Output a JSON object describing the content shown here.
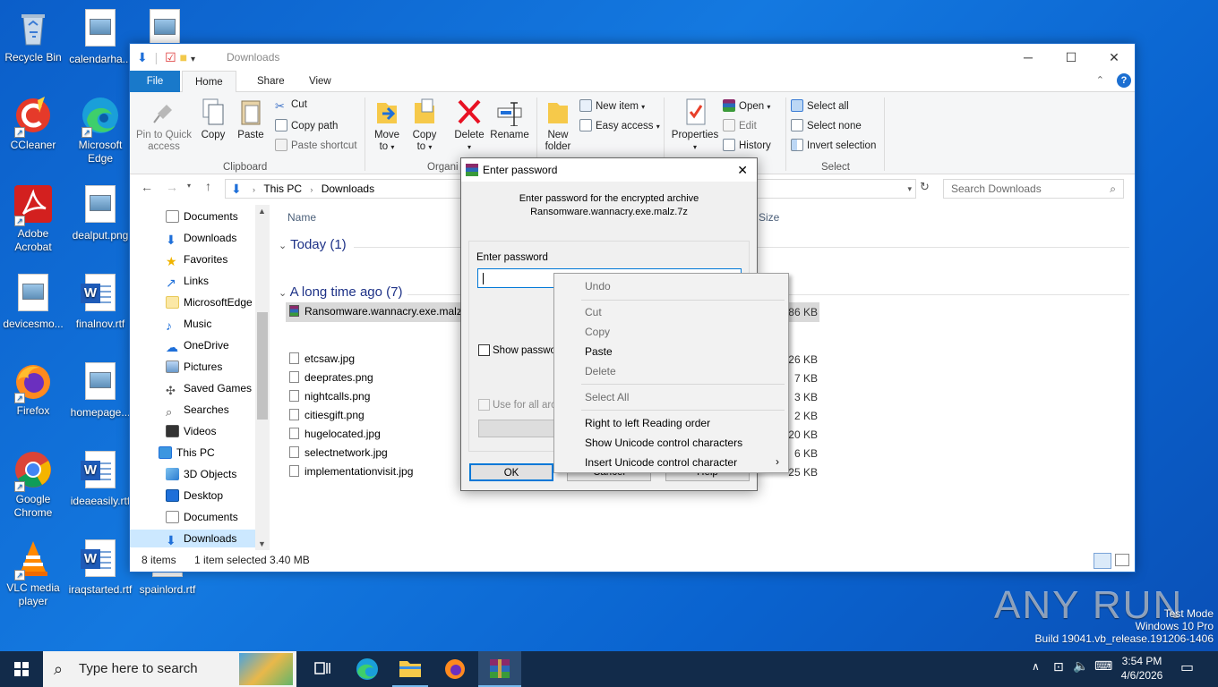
{
  "desktop": {
    "icons": [
      {
        "label": "Recycle Bin"
      },
      {
        "label": "calendarha..."
      },
      {
        "label": "CCleaner"
      },
      {
        "label": "Microsoft Edge"
      },
      {
        "label": "Adobe Acrobat"
      },
      {
        "label": "dealput.png"
      },
      {
        "label": "devicesmo..."
      },
      {
        "label": "finalnov.rtf"
      },
      {
        "label": "Firefox"
      },
      {
        "label": "homepage..."
      },
      {
        "label": "Google Chrome"
      },
      {
        "label": "ideaeasily.rtf"
      },
      {
        "label": "VLC media player"
      },
      {
        "label": "iraqstarted.rtf"
      },
      {
        "label": "spainlord.rtf"
      }
    ]
  },
  "explorer": {
    "title": "Downloads",
    "tabs": {
      "file": "File",
      "home": "Home",
      "share": "Share",
      "view": "View"
    },
    "ribbon": {
      "pin": "Pin to Quick access",
      "copy": "Copy",
      "paste": "Paste",
      "cut": "Cut",
      "copy_path": "Copy path",
      "paste_shortcut": "Paste shortcut",
      "clipboard": "Clipboard",
      "move_to": "Move to",
      "copy_to": "Copy to",
      "delete": "Delete",
      "rename": "Rename",
      "organize": "Organi",
      "new_folder": "New folder",
      "new_item": "New item",
      "easy_access": "Easy access",
      "properties": "Properties",
      "open": "Open",
      "edit": "Edit",
      "history": "History",
      "select_all": "Select all",
      "select_none": "Select none",
      "invert_selection": "Invert selection",
      "select": "Select"
    },
    "address": {
      "this_pc": "This PC",
      "downloads": "Downloads",
      "search_placeholder": "Search Downloads"
    },
    "nav": [
      "Documents",
      "Downloads",
      "Favorites",
      "Links",
      "MicrosoftEdge",
      "Music",
      "OneDrive",
      "Pictures",
      "Saved Games",
      "Searches",
      "Videos",
      "This PC",
      "3D Objects",
      "Desktop",
      "Documents",
      "Downloads"
    ],
    "columns": {
      "name": "Name",
      "size": "Size"
    },
    "groups": {
      "today": "Today (1)",
      "long_ago": "A long time ago (7)"
    },
    "files": [
      {
        "name": "Ransomware.wannacry.exe.malz",
        "size": "3,486 KB"
      },
      {
        "name": "etcsaw.jpg",
        "size": "26 KB"
      },
      {
        "name": "deeprates.png",
        "size": "7 KB"
      },
      {
        "name": "nightcalls.png",
        "size": "3 KB"
      },
      {
        "name": "citiesgift.png",
        "size": "2 KB"
      },
      {
        "name": "hugelocated.jpg",
        "size": "20 KB"
      },
      {
        "name": "selectnetwork.jpg",
        "size": "6 KB"
      },
      {
        "name": "implementationvisit.jpg",
        "size": "25 KB"
      }
    ],
    "status": {
      "items": "8 items",
      "selected": "1 item selected  3.40 MB"
    }
  },
  "dialog": {
    "title": "Enter password",
    "message_line1": "Enter password for the encrypted archive",
    "message_line2": "Ransomware.wannacry.exe.malz.7z",
    "field_label": "Enter password",
    "password_value": "",
    "show_password": "Show passwor",
    "use_for_all": "Use for all arch",
    "ok": "OK",
    "cancel": "Cancel",
    "help": "Help"
  },
  "context_menu": {
    "undo": "Undo",
    "cut": "Cut",
    "copy": "Copy",
    "paste": "Paste",
    "delete": "Delete",
    "select_all": "Select All",
    "rtl": "Right to left Reading order",
    "show_unicode": "Show Unicode control characters",
    "insert_unicode": "Insert Unicode control character"
  },
  "taskbar": {
    "search_placeholder": "Type here to search",
    "time": "3:54 PM",
    "date": "4/6/2026"
  },
  "watermark": {
    "brand": "ANY RUN",
    "mode": "Test Mode",
    "edition": "Windows 10 Pro",
    "build": "Build 19041.vb_release.191206-1406"
  }
}
